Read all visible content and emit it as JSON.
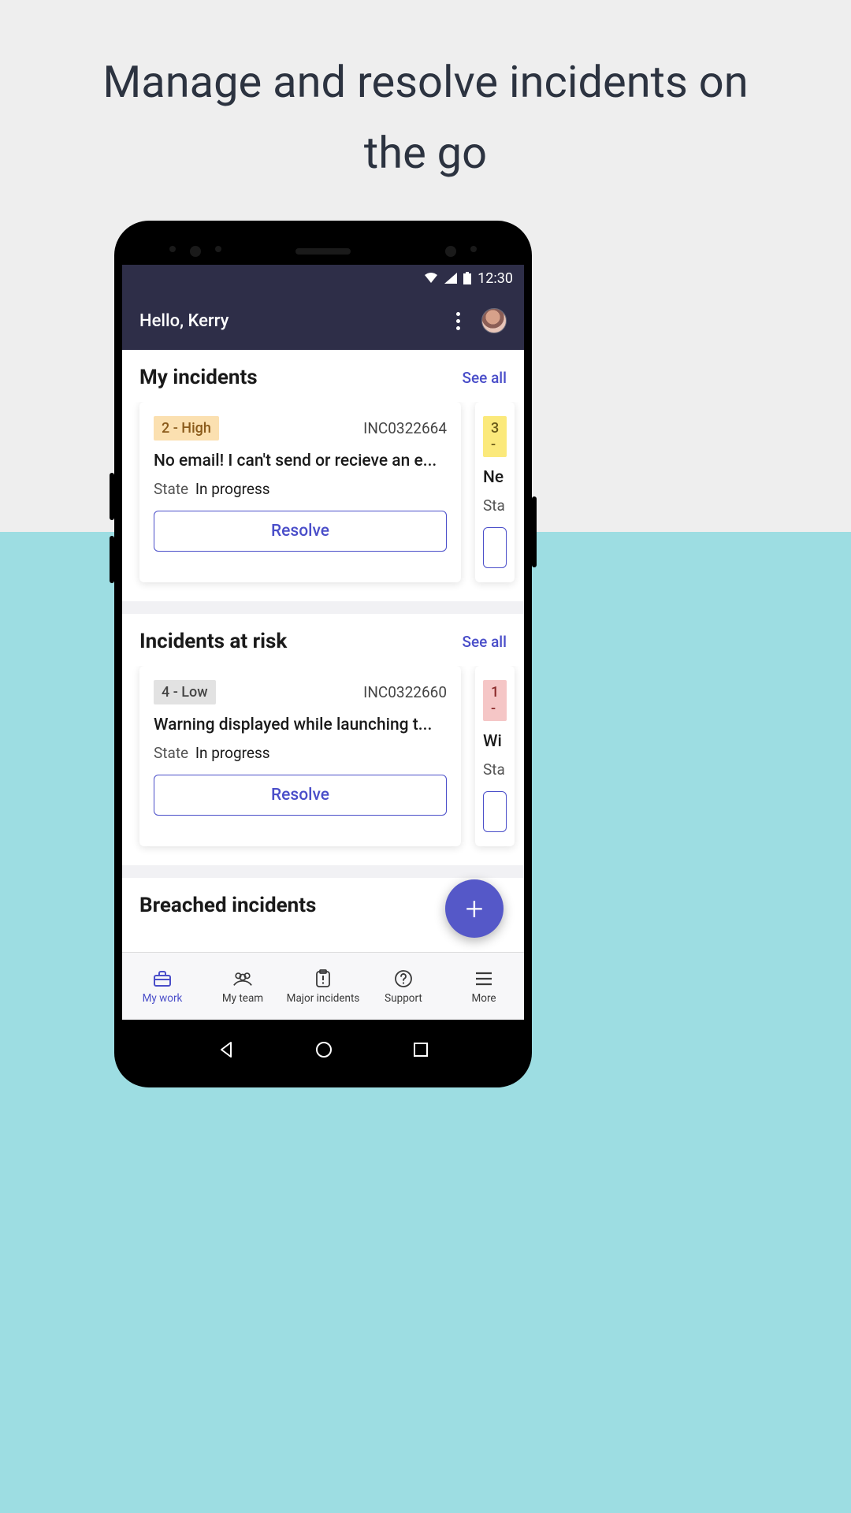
{
  "promo_headline": "Manage and resolve incidents on the go",
  "status_time": "12:30",
  "greeting": "Hello, Kerry",
  "sections": {
    "my_incidents": {
      "title": "My incidents",
      "see_all": "See all",
      "cards": [
        {
          "priority_label": "2 - High",
          "priority_class": "high",
          "id": "INC0322664",
          "title": "No email! I can't send or recieve an e...",
          "state_label": "State",
          "state_value": "In progress",
          "resolve_label": "Resolve"
        },
        {
          "priority_label": "3 -",
          "priority_class": "med",
          "id": "",
          "title": "Ne",
          "state_label": "Sta",
          "state_value": "",
          "resolve_label": ""
        }
      ]
    },
    "at_risk": {
      "title": "Incidents at risk",
      "see_all": "See all",
      "cards": [
        {
          "priority_label": "4 - Low",
          "priority_class": "low",
          "id": "INC0322660",
          "title": "Warning displayed while launching t...",
          "state_label": "State",
          "state_value": "In progress",
          "resolve_label": "Resolve"
        },
        {
          "priority_label": "1 -",
          "priority_class": "crit",
          "id": "",
          "title": "Wi",
          "state_label": "Sta",
          "state_value": "",
          "resolve_label": ""
        }
      ]
    },
    "breached": {
      "title": "Breached incidents"
    }
  },
  "nav": {
    "items": [
      {
        "label": "My work"
      },
      {
        "label": "My team"
      },
      {
        "label": "Major incidents"
      },
      {
        "label": "Support"
      },
      {
        "label": "More"
      }
    ]
  }
}
